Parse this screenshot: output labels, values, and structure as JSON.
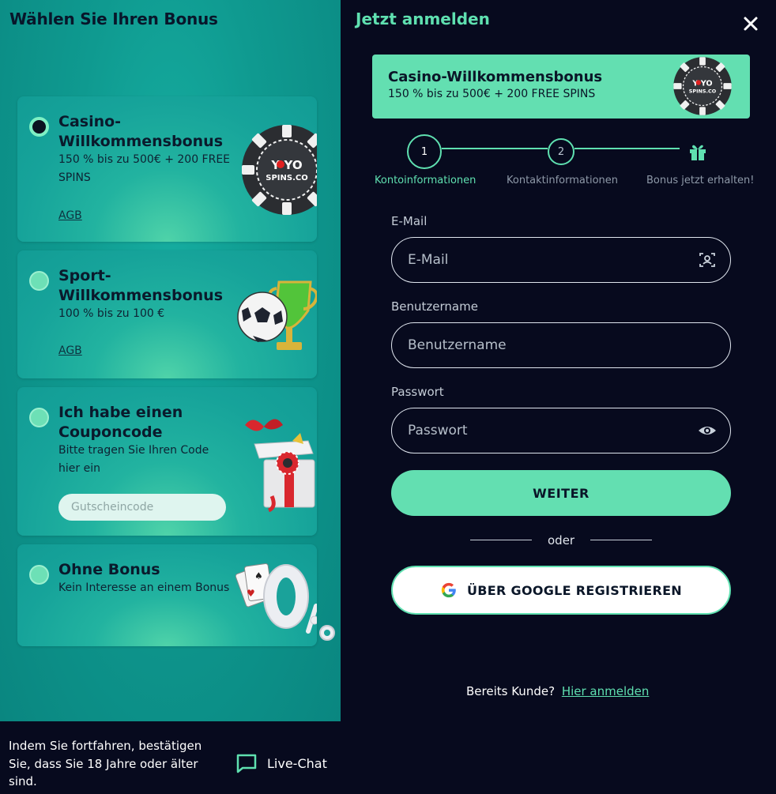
{
  "left": {
    "title": "Wählen Sie Ihren Bonus",
    "cards": [
      {
        "title": "Casino-Willkommensbonus",
        "desc": "150 % bis zu 500€ + 200 FREE SPINS",
        "agb": "AGB",
        "selected": true
      },
      {
        "title": "Sport-Willkommensbonus",
        "desc": "100 % bis zu 100 €",
        "agb": "AGB",
        "selected": false
      },
      {
        "title": "Ich habe einen Couponcode",
        "desc": "Bitte tragen Sie Ihren Code hier ein",
        "coupon_placeholder": "Gutscheincode",
        "selected": false
      },
      {
        "title": "Ohne Bonus",
        "desc": "Kein Interesse an einem Bonus",
        "selected": false
      }
    ],
    "chip_logo_line1": "Y YO",
    "chip_logo_line2": "SPINS.CO",
    "footer_text": "Indem Sie fortfahren, bestätigen Sie, dass Sie 18 Jahre oder älter sind.",
    "livechat_label": "Live-Chat"
  },
  "right": {
    "title": "Jetzt anmelden",
    "banner": {
      "title": "Casino-Willkommensbonus",
      "desc": "150 % bis zu 500€ + 200 FREE SPINS"
    },
    "steps": [
      {
        "number": "1",
        "label": "Kontoinformationen"
      },
      {
        "number": "2",
        "label": "Kontaktinformationen"
      },
      {
        "label": "Bonus jetzt erhalten!"
      }
    ],
    "fields": {
      "email": {
        "label": "E-Mail",
        "placeholder": "E-Mail"
      },
      "username": {
        "label": "Benutzername",
        "placeholder": "Benutzername"
      },
      "password": {
        "label": "Passwort",
        "placeholder": "Passwort"
      }
    },
    "weiter_label": "WEITER",
    "oder": "oder",
    "google_label": "ÜBER GOOGLE REGISTRIEREN",
    "already_text": "Bereits Kunde?",
    "login_link": "Hier anmelden"
  },
  "colors": {
    "accent": "#63dfb1",
    "panel": "#070a1e",
    "teal": "#129c95"
  }
}
